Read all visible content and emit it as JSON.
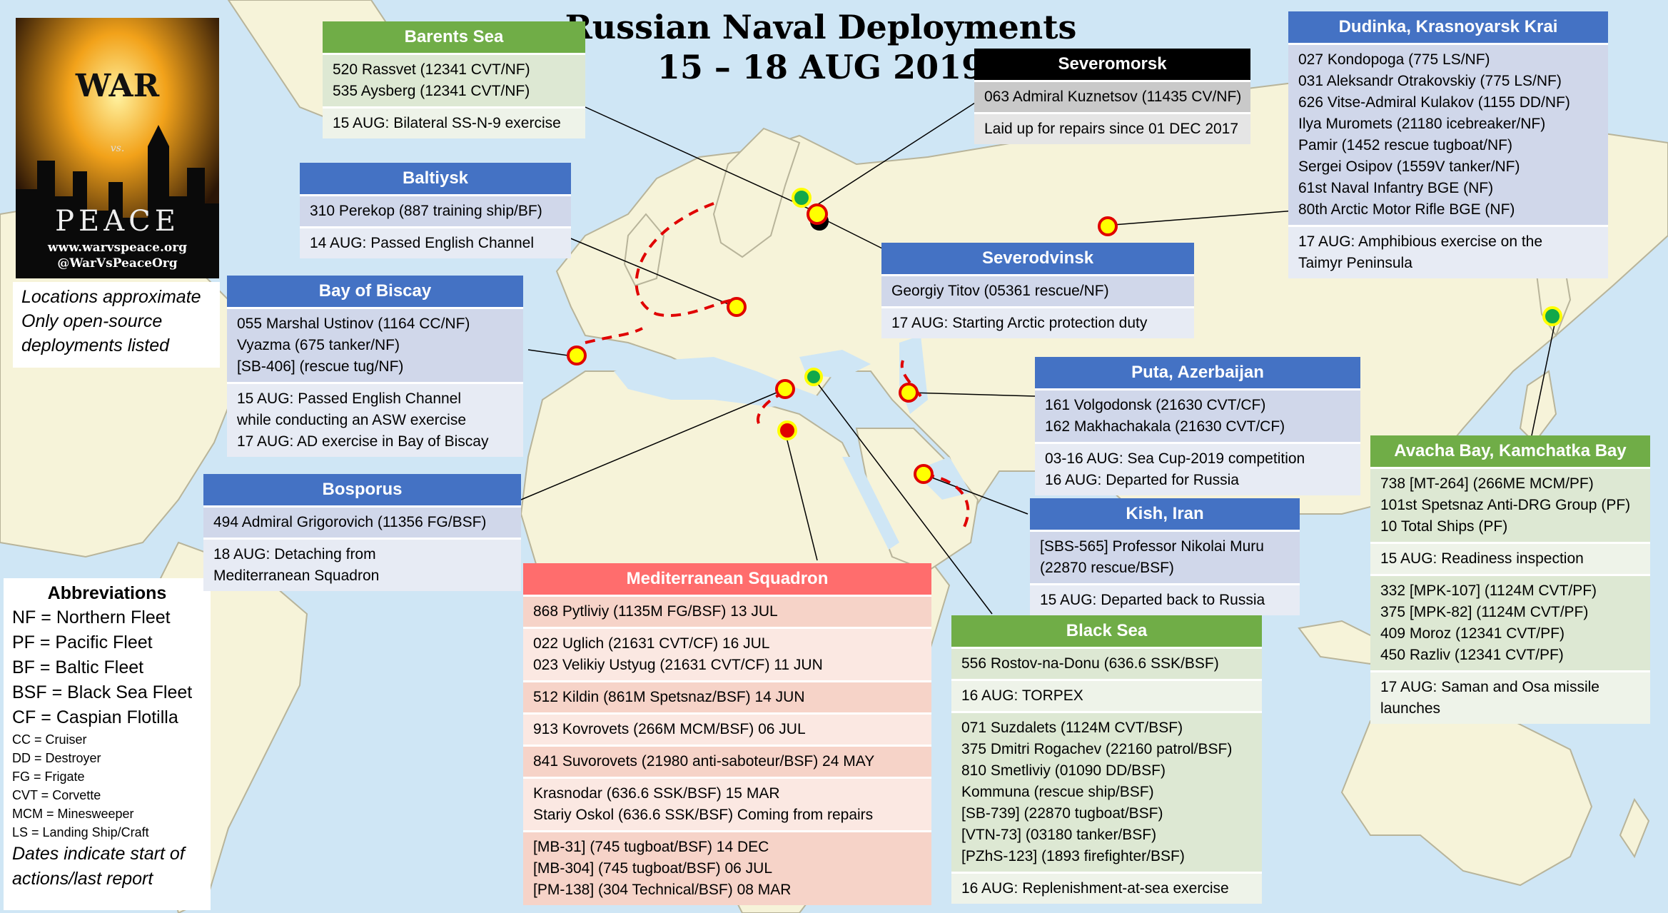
{
  "title": {
    "line1": "Russian Naval Deployments",
    "line2": "15 – 18 AUG 2019"
  },
  "poster": {
    "word1": "WAR",
    "vs": "vs.",
    "word2": "PEACE",
    "url": "www.warvspeace.org",
    "handle": "@WarVsPeaceOrg"
  },
  "note": {
    "line1": "Locations approximate",
    "line2": "Only open-source",
    "line3": "deployments listed"
  },
  "abbreviations": {
    "heading": "Abbreviations",
    "fleets": [
      "NF = Northern Fleet",
      "PF = Pacific Fleet",
      "BF = Baltic Fleet",
      "BSF = Black Sea Fleet",
      "CF = Caspian Flotilla"
    ],
    "types": [
      "CC = Cruiser",
      "DD = Destroyer",
      "FG = Frigate",
      "CVT = Corvette",
      "MCM = Minesweeper",
      "LS = Landing Ship/Craft"
    ],
    "footer1": "Dates indicate start of",
    "footer2": "actions/last report"
  },
  "boxes": {
    "barents": {
      "header": "Barents Sea",
      "rows": [
        [
          "520 Rassvet (12341 CVT/NF)",
          "535 Aysberg (12341 CVT/NF)"
        ],
        [
          "15 AUG: Bilateral SS-N-9 exercise"
        ]
      ]
    },
    "severomorsk": {
      "header": "Severomorsk",
      "rows": [
        [
          "063 Admiral Kuznetsov (11435 CV/NF)"
        ],
        [
          "Laid up for repairs since 01 DEC 2017"
        ]
      ]
    },
    "dudinka": {
      "header": "Dudinka, Krasnoyarsk Krai",
      "rows": [
        [
          "027 Kondopoga (775 LS/NF)",
          "031 Aleksandr Otrakovskiy (775 LS/NF)",
          "626 Vitse-Admiral Kulakov (1155 DD/NF)",
          "Ilya Muromets (21180 icebreaker/NF)",
          "Pamir (1452 rescue tugboat/NF)",
          "Sergei Osipov (1559V tanker/NF)",
          "61st Naval Infantry BGE (NF)",
          "80th Arctic Motor Rifle BGE (NF)"
        ],
        [
          "17 AUG: Amphibious exercise on the",
          "Taimyr Peninsula"
        ]
      ]
    },
    "baltiysk": {
      "header": "Baltiysk",
      "rows": [
        [
          "310 Perekop (887 training ship/BF)"
        ],
        [
          "14 AUG: Passed English Channel"
        ]
      ]
    },
    "severodvinsk": {
      "header": "Severodvinsk",
      "rows": [
        [
          "Georgiy Titov (05361 rescue/NF)"
        ],
        [
          "17 AUG: Starting Arctic protection duty"
        ]
      ]
    },
    "biscay": {
      "header": "Bay of Biscay",
      "rows": [
        [
          "055 Marshal Ustinov (1164 CC/NF)",
          "Vyazma (675 tanker/NF)",
          "[SB-406] (rescue tug/NF)"
        ],
        [
          "15 AUG: Passed English Channel",
          "while conducting an ASW exercise",
          "17 AUG: AD exercise in Bay of Biscay"
        ]
      ]
    },
    "puta": {
      "header": "Puta, Azerbaijan",
      "rows": [
        [
          "161 Volgodonsk (21630 CVT/CF)",
          "162 Makhachakala (21630 CVT/CF)"
        ],
        [
          "03-16 AUG: Sea Cup-2019 competition",
          "16 AUG: Departed for Russia"
        ]
      ]
    },
    "bosporus": {
      "header": "Bosporus",
      "rows": [
        [
          "494 Admiral Grigorovich (11356 FG/BSF)"
        ],
        [
          "18 AUG: Detaching from",
          "Mediterranean Squadron"
        ]
      ]
    },
    "kish": {
      "header": "Kish, Iran",
      "rows": [
        [
          "[SBS-565] Professor Nikolai Muru",
          "(22870 rescue/BSF)"
        ],
        [
          "15 AUG: Departed back to Russia"
        ]
      ]
    },
    "avacha": {
      "header": "Avacha Bay, Kamchatka Bay",
      "rows": [
        [
          "738 [MT-264] (266ME MCM/PF)",
          "101st Spetsnaz Anti-DRG Group (PF)",
          "10 Total Ships (PF)"
        ],
        [
          "15 AUG: Readiness inspection"
        ],
        [
          "332 [MPK-107] (1124M CVT/PF)",
          "375 [MPK-82] (1124M CVT/PF)",
          "409 Moroz (12341 CVT/PF)",
          "450 Razliv (12341 CVT/PF)"
        ],
        [
          "17 AUG: Saman and Osa missile",
          "launches"
        ]
      ]
    },
    "med": {
      "header": "Mediterranean Squadron",
      "rows": [
        [
          "868 Pytliviy (1135M FG/BSF) 13 JUL"
        ],
        [
          "022 Uglich (21631 CVT/CF) 16 JUL",
          "023 Velikiy Ustyug (21631 CVT/CF) 11 JUN"
        ],
        [
          "512 Kildin (861M Spetsnaz/BSF) 14 JUN"
        ],
        [
          "913 Kovrovets (266M MCM/BSF) 06 JUL"
        ],
        [
          "841 Suvorovets (21980 anti-saboteur/BSF) 24 MAY"
        ],
        [
          "Krasnodar (636.6 SSK/BSF) 15 MAR",
          "Stariy Oskol (636.6 SSK/BSF) Coming from repairs"
        ],
        [
          "[MB-31] (745 tugboat/BSF) 14 DEC",
          "[MB-304] (745 tugboat/BSF) 06 JUL",
          "[PM-138] (304 Technical/BSF) 08 MAR"
        ]
      ]
    },
    "blacksea": {
      "header": "Black Sea",
      "rows": [
        [
          "556 Rostov-na-Donu (636.6 SSK/BSF)"
        ],
        [
          "16 AUG: TORPEX"
        ],
        [
          "071 Suzdalets (1124M CVT/BSF)",
          "375 Dmitri Rogachev (22160 patrol/BSF)",
          "810 Smetliviy (01090 DD/BSF)",
          "Kommuna (rescue ship/BSF)",
          "[SB-739] (22870 tugboat/BSF)",
          "[VTN-73] (03180 tanker/BSF)",
          "[PZhS-123] (1893 firefighter/BSF)"
        ],
        [
          "16 AUG: Replenishment-at-sea exercise"
        ]
      ]
    }
  },
  "colors": {
    "sea": "#cfe6f5",
    "land": "#f6f3d9",
    "headerBlue": "#4472c4",
    "headerGreen": "#70ad47",
    "headerRed": "#ff6d6d",
    "markerYellow": "#ffff00",
    "markerRed": "#e00000",
    "markerGreen": "#12a84a",
    "route": "#e00000"
  }
}
